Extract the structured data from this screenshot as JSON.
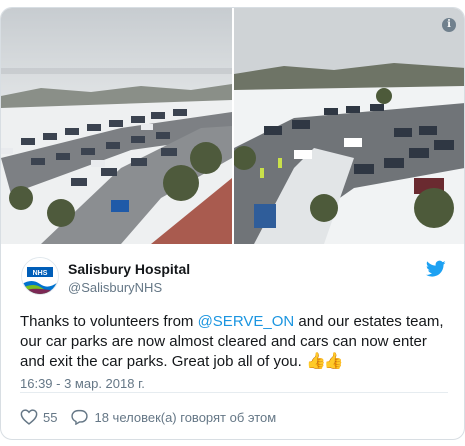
{
  "tweet": {
    "author_name": "Salisbury Hospital",
    "author_handle": "@SalisburyNHS",
    "text_before": "Thanks to volunteers from ",
    "mention": "@SERVE_ON",
    "text_after": " and our estates team, our car parks are now almost cleared and cars can now enter and exit the car parks. Great job all of you. ",
    "emoji": "👍👍",
    "timestamp": "16:39 - 3 мар. 2018 г.",
    "likes": "55",
    "replies_text": "18 человек(а) говорят об этом"
  },
  "media": {
    "count": 2,
    "info_icon_label": "i"
  },
  "icons": {
    "info": "info-icon",
    "bird": "twitter-bird-icon",
    "heart": "heart-icon",
    "reply": "speech-bubble-icon"
  },
  "colors": {
    "link": "#1b95e0",
    "muted": "#657786",
    "twitter_blue": "#1da1f2",
    "nhs_blue": "#005eb8"
  }
}
